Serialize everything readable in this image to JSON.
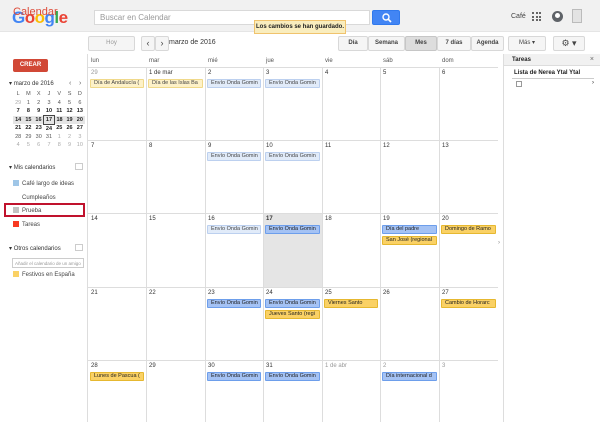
{
  "header": {
    "logo": "Google",
    "search_placeholder": "Buscar en Calendar",
    "toast": "Los cambios se han guardado.",
    "user": "Café"
  },
  "toolbar": {
    "title": "Calendar",
    "today": "Hoy",
    "prev": "‹",
    "next": "›",
    "current": "marzo de 2016",
    "views": [
      "Día",
      "Semana",
      "Mes",
      "7 días",
      "Agenda"
    ],
    "active_view": "Mes",
    "more": "Más ▾",
    "settings": "⚙ ▾"
  },
  "sidebar": {
    "create": "CREAR",
    "mini_title": "marzo de 2016",
    "mini_nav": [
      "‹",
      "›"
    ],
    "mini_weekdays": [
      "L",
      "M",
      "X",
      "J",
      "V",
      "S",
      "D"
    ],
    "mini_weeks": [
      [
        "29",
        "1",
        "2",
        "3",
        "4",
        "5",
        "6"
      ],
      [
        "7",
        "8",
        "9",
        "10",
        "11",
        "12",
        "13"
      ],
      [
        "14",
        "15",
        "16",
        "17",
        "18",
        "19",
        "20"
      ],
      [
        "21",
        "22",
        "23",
        "24",
        "25",
        "26",
        "27"
      ],
      [
        "28",
        "29",
        "30",
        "31",
        "1",
        "2",
        "3"
      ],
      [
        "4",
        "5",
        "6",
        "7",
        "8",
        "9",
        "10"
      ]
    ],
    "my_calendars_title": "Mis calendarios",
    "my_calendars": [
      {
        "label": "Café largo de ideas",
        "color": "#9fc6e7"
      },
      {
        "label": "Cumpleaños",
        "color": ""
      },
      {
        "label": "Prueba",
        "color": "#c2c2c2"
      },
      {
        "label": "Tareas",
        "color": "#f83a22"
      }
    ],
    "other_calendars_title": "Otros calendarios",
    "add_other_placeholder": "Añadir el calendario de un amigo",
    "other_calendars": [
      {
        "label": "Festivos en España",
        "color": "#fad165"
      }
    ]
  },
  "month": {
    "weekdays": [
      "lun",
      "mar",
      "mié",
      "jue",
      "vie",
      "sáb",
      "dom"
    ],
    "weeks": [
      [
        "29",
        "1 de mar",
        "2",
        "3",
        "4",
        "5",
        "6"
      ],
      [
        "7",
        "8",
        "9",
        "10",
        "11",
        "12",
        "13"
      ],
      [
        "14",
        "15",
        "16",
        "17",
        "18",
        "19",
        "20"
      ],
      [
        "21",
        "22",
        "23",
        "24",
        "25",
        "26",
        "27"
      ],
      [
        "28",
        "29",
        "30",
        "31",
        "1 de abr",
        "2",
        "3"
      ]
    ],
    "events": [
      {
        "text": "Día de Andalucía (",
        "style": "yellow light"
      },
      {
        "text": "Día de las Islas Ba",
        "style": "yellow light"
      },
      {
        "text": "Envío Onda Gomin",
        "style": "blue light"
      },
      {
        "text": "Envío Onda Gomin",
        "style": "blue light"
      },
      {
        "text": "Envío Onda Gomin",
        "style": "blue light"
      },
      {
        "text": "Envío Onda Gomin",
        "style": "blue light"
      },
      {
        "text": "Envío Onda Gomin",
        "style": "blue light"
      },
      {
        "text": "Envío Onda Gomin",
        "style": "blue"
      },
      {
        "text": "Día del padre",
        "style": "blue"
      },
      {
        "text": "San José (regional",
        "style": "yellow"
      },
      {
        "text": "Domingo de Ramo",
        "style": "yellow"
      },
      {
        "text": "Envío Onda Gomin",
        "style": "blue"
      },
      {
        "text": "Envío Onda Gomin",
        "style": "blue"
      },
      {
        "text": "Jueves Santo (regi",
        "style": "yellow"
      },
      {
        "text": "Viernes Santo",
        "style": "yellow"
      },
      {
        "text": "Cambio de Horarc",
        "style": "yellow"
      },
      {
        "text": "Lunes de Pascua (",
        "style": "yellow"
      },
      {
        "text": "Envío Onda Gomin",
        "style": "blue"
      },
      {
        "text": "Envío Onda Gomin",
        "style": "blue"
      },
      {
        "text": "Día internacional d",
        "style": "blue"
      }
    ]
  },
  "tasks": {
    "title": "Tareas",
    "close": "×",
    "list_name": "Lista de Nerea Ytal Ytal",
    "chevron": "›"
  }
}
